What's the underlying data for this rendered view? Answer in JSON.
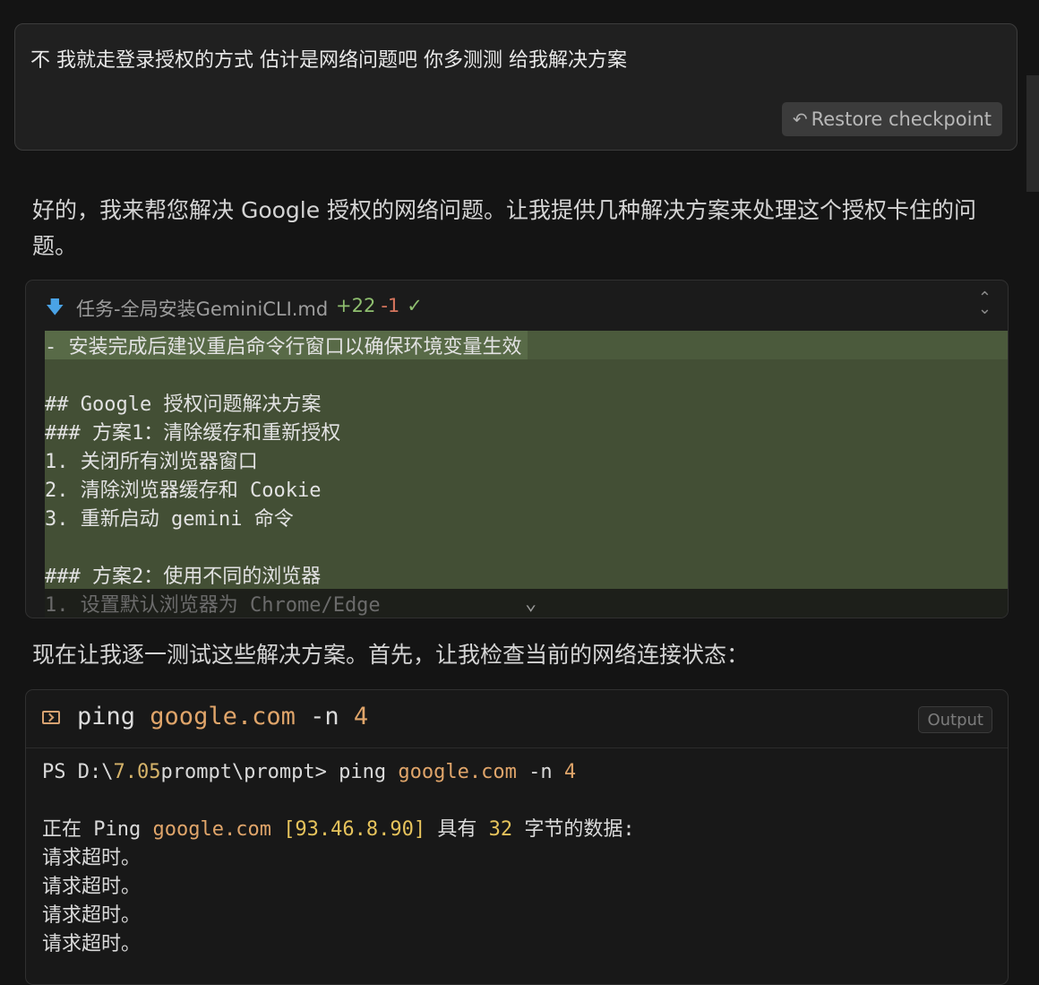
{
  "user_message": {
    "text": "不 我就走登录授权的方式 估计是网络问题吧 你多测测 给我解决方案",
    "restore_label": "Restore checkpoint"
  },
  "assistant": {
    "intro": "好的，我来帮您解决 Google 授权的网络问题。让我提供几种解决方案来处理这个授权卡住的问题。",
    "followup": "现在让我逐一测试这些解决方案。首先，让我检查当前的网络连接状态："
  },
  "diff": {
    "filename": "任务-全局安装GeminiCLI.md",
    "additions": "+22",
    "deletions": "-1",
    "lines": [
      "- 安装完成后建议重启命令行窗口以确保环境变量生效",
      "",
      "## Google 授权问题解决方案",
      "### 方案1：清除缓存和重新授权",
      "1. 关闭所有浏览器窗口",
      "2. 清除浏览器缓存和 Cookie",
      "3. 重新启动 gemini 命令",
      "",
      "### 方案2：使用不同的浏览器"
    ],
    "faded_line": "1. 设置默认浏览器为 Chrome/Edge"
  },
  "terminal": {
    "cmd_name": "ping",
    "cmd_host": "google.com",
    "cmd_flag": "-n",
    "cmd_count": "4",
    "output_label": "Output",
    "prompt_prefix": "PS D:\\",
    "prompt_path_num": "7.05",
    "prompt_path_rest": "prompt\\prompt> ping ",
    "prompt_host": "google.com",
    "prompt_flag": " -n ",
    "prompt_count": "4",
    "ping_prefix": "正在 Ping ",
    "ping_host": "google.com",
    "ping_ip": "[93.46.8.90]",
    "ping_mid": " 具有 ",
    "ping_bytes": "32",
    "ping_suffix": " 字节的数据:",
    "timeouts": [
      "请求超时。",
      "请求超时。",
      "请求超时。",
      "请求超时。"
    ]
  }
}
